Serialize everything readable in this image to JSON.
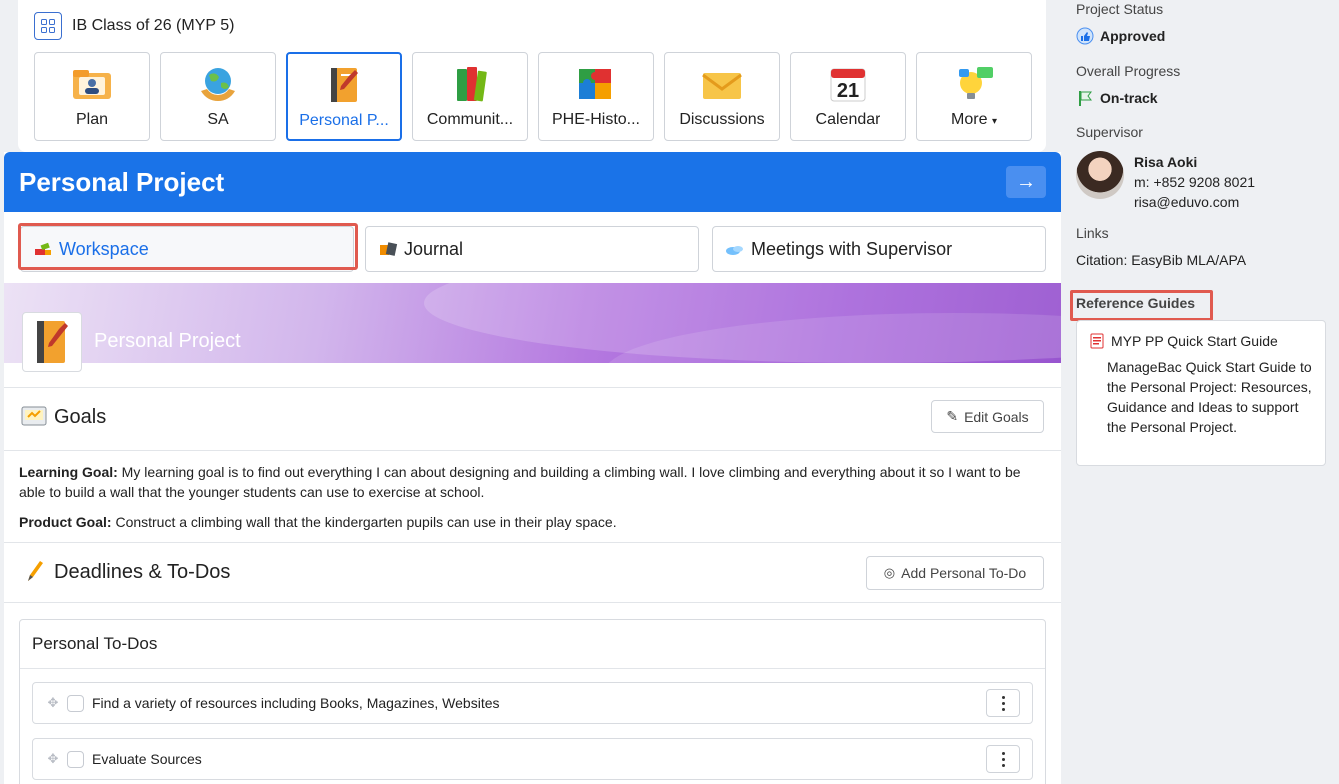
{
  "class_bar": {
    "title": "IB Class of 26 (MYP 5)",
    "tiles": [
      {
        "label": "Plan",
        "icon": "folder-person-icon"
      },
      {
        "label": "SA",
        "icon": "globe-hands-icon"
      },
      {
        "label": "Personal P...",
        "icon": "notebook-pencil-icon",
        "active": true
      },
      {
        "label": "Communit...",
        "icon": "books-icon"
      },
      {
        "label": "PHE-Histo...",
        "icon": "puzzle-icon"
      },
      {
        "label": "Discussions",
        "icon": "envelope-icon"
      },
      {
        "label": "Calendar",
        "icon": "calendar-icon",
        "day": "21"
      },
      {
        "label": "More",
        "icon": "lightbulb-chat-icon"
      }
    ]
  },
  "project": {
    "title": "Personal Project",
    "tabs": {
      "workspace": "Workspace",
      "journal": "Journal",
      "meetings": "Meetings with Supervisor"
    },
    "banner_title": "Personal Project",
    "goals": {
      "title": "Goals",
      "edit_label": "Edit Goals",
      "learning_label": "Learning Goal:",
      "learning_text": " My learning goal is to find out everything I can about designing and building a climbing wall. I love climbing and everything about it so I want to be able to build a wall that the younger students can use to exercise at school.",
      "product_label": "Product Goal:",
      "product_text": " Construct a climbing wall that the kindergarten pupils can use in their play space."
    },
    "deadlines": {
      "title": "Deadlines & To-Dos",
      "add_label": "Add Personal To-Do",
      "todo_heading": "Personal To-Dos",
      "todos": [
        "Find a variety of resources including Books, Magazines, Websites",
        "Evaluate Sources"
      ]
    }
  },
  "side": {
    "status_label": "Project Status",
    "status_value": "Approved",
    "progress_label": "Overall Progress",
    "progress_value": "On-track",
    "supervisor_label": "Supervisor",
    "supervisor_name": "Risa Aoki",
    "supervisor_phone": "m: +852 9208 8021",
    "supervisor_email": "risa@eduvo.com",
    "links_label": "Links",
    "links_value": "Citation: EasyBib MLA/APA",
    "ref_label": "Reference Guides",
    "ref_title": "MYP PP Quick Start Guide",
    "ref_desc": "ManageBac Quick Start Guide to the Personal Project: Resources, Guidance and Ideas to support the Personal Project."
  },
  "colors": {
    "primary": "#1a73e8",
    "highlight": "#e05a4f",
    "banner_end": "#8a3ec9"
  }
}
